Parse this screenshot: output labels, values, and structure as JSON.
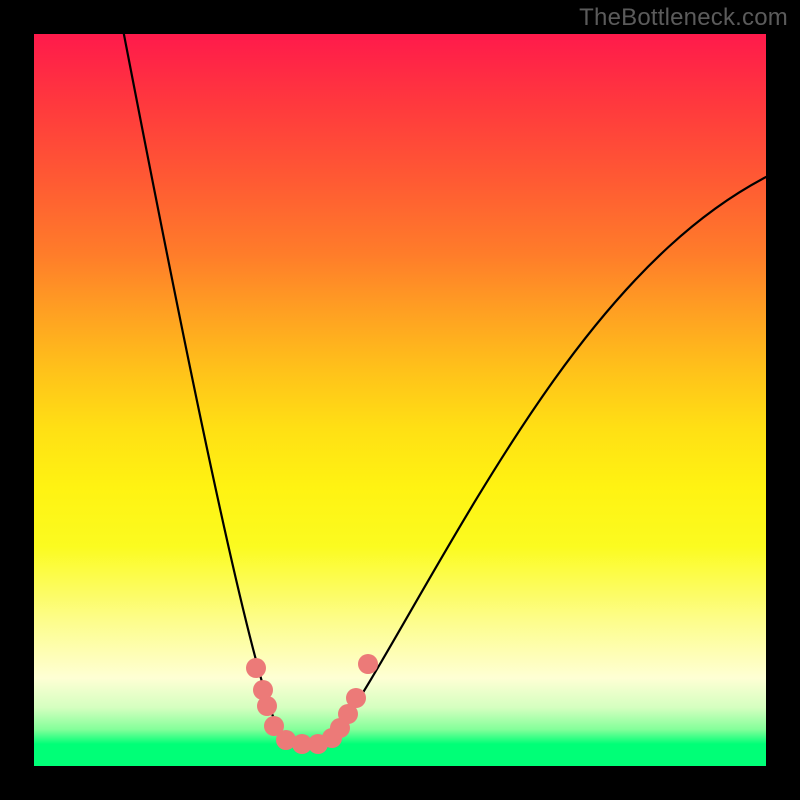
{
  "watermark": "TheBottleneck.com",
  "chart_data": {
    "type": "line",
    "title": "",
    "xlabel": "",
    "ylabel": "",
    "xlim": [
      0,
      100
    ],
    "ylim": [
      0,
      100
    ],
    "grid": false,
    "legend_position": "none",
    "annotations": [
      "TheBottleneck.com"
    ],
    "background": {
      "kind": "vertical-gradient",
      "stops": [
        {
          "pos": 0,
          "color": "#ff1a4b"
        },
        {
          "pos": 38,
          "color": "#ffa022"
        },
        {
          "pos": 62,
          "color": "#fff312"
        },
        {
          "pos": 88,
          "color": "#feffd4"
        },
        {
          "pos": 97,
          "color": "#00ff77"
        },
        {
          "pos": 100,
          "color": "#00ff77"
        }
      ]
    },
    "series": [
      {
        "name": "bottleneck-curve",
        "color": "#000000",
        "x": [
          12,
          16,
          20,
          24,
          28,
          32,
          35,
          38,
          40,
          42,
          46,
          52,
          60,
          70,
          82,
          95,
          100
        ],
        "y": [
          100,
          80,
          62,
          46,
          32,
          20,
          10,
          4,
          2,
          4,
          12,
          26,
          42,
          58,
          72,
          80,
          82
        ]
      }
    ],
    "markers": {
      "name": "valley-points",
      "color": "#ec7a78",
      "x": [
        30,
        31,
        32,
        33,
        34,
        36,
        38,
        40,
        41,
        42,
        43,
        45
      ],
      "y": [
        14,
        11,
        9,
        6,
        4,
        3,
        3,
        4,
        5,
        7,
        9,
        14
      ]
    }
  }
}
